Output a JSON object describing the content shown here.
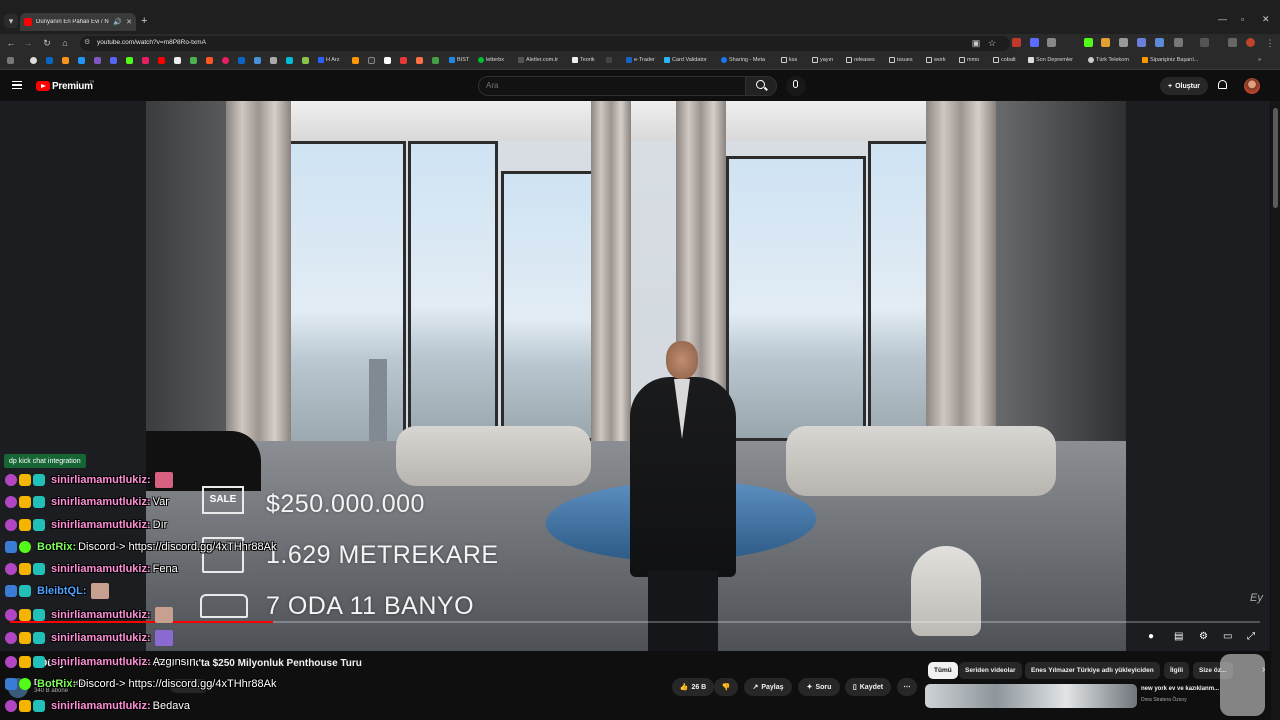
{
  "browser": {
    "tab_title": "Dünyanın En Pahalı Evi / New York",
    "url": "youtube.com/watch?v=m8P8Ro-txmA",
    "bookmarks": [
      "H Arz",
      "BIST",
      "letterbx",
      "Aletler.com.tr",
      "Teorik",
      "e-Trader",
      "Card Validator",
      "Sharing - Meta",
      "kss",
      "yayın",
      "releases",
      "issues",
      "work",
      "mmo",
      "cobalt",
      "Son Depremler",
      "Türk Telekom",
      "Siparişiniz Başarıl..."
    ]
  },
  "youtube": {
    "logo_text": "Premium",
    "region": "TR",
    "search_placeholder": "Ara",
    "create_label": "Oluştur"
  },
  "video": {
    "overlay": {
      "sale_badge": "SALE",
      "price": "$250.000.000",
      "area": "1.629 METREKARE",
      "rooms": "7 ODA 11 BANYO"
    },
    "progress": 0.21,
    "watermark": "Ey",
    "title": "Dünyanın En Pahalı Evi New York'ta $250 Milyonluk Penthouse Turu",
    "channel": "Dora Stratera",
    "subscribers": "340 B abone"
  },
  "actions": {
    "likes": "26 B",
    "share": "Paylaş",
    "ask": "Soru",
    "save": "Kaydet"
  },
  "chips": [
    "Tümü",
    "Seriden videolar",
    "Enes Yılmazer Türkiye adlı yükleyiciden",
    "İlgili",
    "Size öz..."
  ],
  "recommendation": {
    "title": "new york ev ve kazıklanm...",
    "channel": "Dora Stratera Özsoy"
  },
  "chat": {
    "header": "dp kick chat integration",
    "messages": [
      {
        "user": "sinirliamamutlukiz:",
        "text": "",
        "user_color": "#ff8fd6"
      },
      {
        "user": "sinirliamamutlukiz:",
        "text": "Var",
        "user_color": "#ff8fd6"
      },
      {
        "user": "sinirliamamutlukiz:",
        "text": "Dır",
        "user_color": "#ff8fd6"
      },
      {
        "user": "BotRix:",
        "text": "Discord-> https://discord.gg/4xTHhr88Ak",
        "user_color": "#7cfc5a"
      },
      {
        "user": "sinirliamamutlukiz:",
        "text": "Fena",
        "user_color": "#ff8fd6"
      },
      {
        "user": "BleibtQL:",
        "text": "",
        "user_color": "#4fa3ff"
      },
      {
        "user": "sinirliamamutlukiz:",
        "text": "",
        "user_color": "#ff8fd6"
      },
      {
        "user": "sinirliamamutlukiz:",
        "text": "",
        "user_color": "#ff8fd6"
      },
      {
        "user": "sinirliamamutlukiz:",
        "text": "Azgınsın",
        "user_color": "#ff8fd6"
      },
      {
        "user": "BotRix:",
        "text": "Discord-> https://discord.gg/4xTHhr88Ak",
        "user_color": "#7cfc5a"
      },
      {
        "user": "sinirliamamutlukiz:",
        "text": "Bedava",
        "user_color": "#ff8fd6"
      }
    ]
  },
  "colors": {
    "youtube_red": "#ff0000",
    "kick_green": "#53fc18",
    "background": "#0f0f0f"
  }
}
